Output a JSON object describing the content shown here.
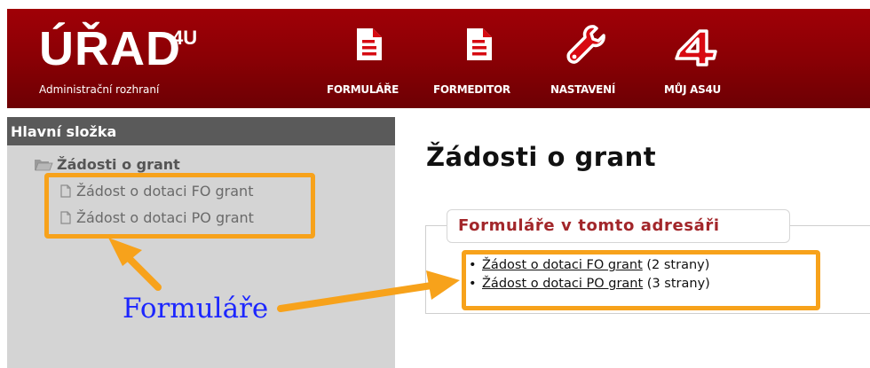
{
  "app": {
    "brand_title": "ÚŘAD",
    "brand_sup": "4U",
    "brand_subtitle": "Administrační rozhraní"
  },
  "nav": [
    {
      "label": "FORMULÁŘE",
      "icon": "document-icon"
    },
    {
      "label": "FORMEDITOR",
      "icon": "document-icon"
    },
    {
      "label": "NASTAVENÍ",
      "icon": "wrench-icon"
    },
    {
      "label": "MŮJ AS4U",
      "icon": "as4u-logo-icon"
    }
  ],
  "sidebar": {
    "heading": "Hlavní složka",
    "folder": "Žádosti o grant",
    "items": [
      {
        "label": "Žádost o dotaci FO grant"
      },
      {
        "label": "Žádost o dotaci PO grant"
      }
    ]
  },
  "main": {
    "title": "Žádosti o grant",
    "legend": "Formuláře v tomto adresáři",
    "forms": [
      {
        "link": "Žádost o dotaci FO grant",
        "pages": "(2 strany)"
      },
      {
        "link": "Žádost o dotaci PO grant",
        "pages": "(3 strany)"
      }
    ]
  },
  "annotation": {
    "label": "Formuláře",
    "color": "#1c26ff",
    "highlight_color": "#f7a21b"
  },
  "colors": {
    "header_red": "#8a0005",
    "sidebar_bg": "#d4d4d4",
    "sidebar_head_bg": "#5a5a5a",
    "legend_text": "#a2262a"
  }
}
